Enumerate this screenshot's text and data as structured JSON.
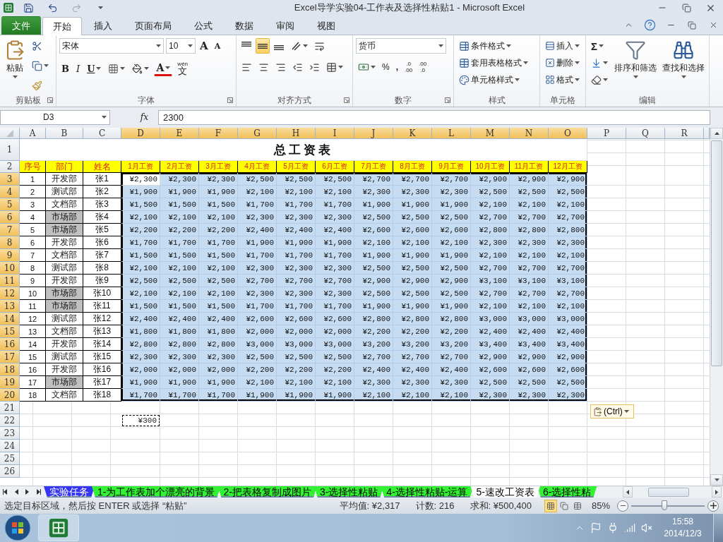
{
  "window": {
    "title": "Excel导学实验04-工作表及选择性粘贴1  -  Microsoft Excel"
  },
  "ribbon_tabs": [
    {
      "label": "文件",
      "kind": "file",
      "selected": false
    },
    {
      "label": "开始",
      "kind": "tab",
      "selected": true
    },
    {
      "label": "插入",
      "kind": "tab",
      "selected": false
    },
    {
      "label": "页面布局",
      "kind": "tab",
      "selected": false
    },
    {
      "label": "公式",
      "kind": "tab",
      "selected": false
    },
    {
      "label": "数据",
      "kind": "tab",
      "selected": false
    },
    {
      "label": "审阅",
      "kind": "tab",
      "selected": false
    },
    {
      "label": "视图",
      "kind": "tab",
      "selected": false
    }
  ],
  "ribbon": {
    "clipboard": {
      "label": "剪贴板",
      "paste": "粘贴"
    },
    "font": {
      "label": "字体",
      "font_name": "宋体",
      "font_size": "10",
      "grow": "A",
      "shrink": "A",
      "bold": "B",
      "italic": "I",
      "underline": "U",
      "color_letter": "A",
      "phonetic_top": "wén",
      "phonetic_char": "文"
    },
    "alignment": {
      "label": "对齐方式",
      "vertical": [
        {
          "selected": false
        },
        {
          "selected": true
        },
        {
          "selected": false
        }
      ]
    },
    "number": {
      "label": "数字",
      "format": "货币",
      "percent": "%",
      "comma": ",",
      "increase_top": ".0",
      "increase_bottom": ".00",
      "decrease_top": ".00",
      "decrease_bottom": ".0"
    },
    "styles": {
      "label": "样式",
      "items": [
        "条件格式",
        "套用表格格式",
        "单元格样式"
      ]
    },
    "cells": {
      "label": "单元格",
      "items": [
        "插入",
        "删除",
        "格式"
      ]
    },
    "editing": {
      "label": "编辑",
      "sum": "Σ",
      "sort": "排序和筛选",
      "find": "查找和选择"
    }
  },
  "formula_bar": {
    "name_box": "D3",
    "function_label": "fx",
    "content": "2300"
  },
  "columns": [
    {
      "label": "A",
      "selected": false
    },
    {
      "label": "B",
      "selected": false
    },
    {
      "label": "C",
      "selected": false
    },
    {
      "label": "D",
      "selected": true
    },
    {
      "label": "E",
      "selected": true
    },
    {
      "label": "F",
      "selected": true
    },
    {
      "label": "G",
      "selected": true
    },
    {
      "label": "H",
      "selected": true
    },
    {
      "label": "I",
      "selected": true
    },
    {
      "label": "J",
      "selected": true
    },
    {
      "label": "K",
      "selected": true
    },
    {
      "label": "L",
      "selected": true
    },
    {
      "label": "M",
      "selected": true
    },
    {
      "label": "N",
      "selected": true
    },
    {
      "label": "O",
      "selected": true
    },
    {
      "label": "P",
      "selected": false
    },
    {
      "label": "Q",
      "selected": false
    },
    {
      "label": "R",
      "selected": false
    }
  ],
  "title_row": {
    "num": "1",
    "selected": false,
    "title": "总工资表"
  },
  "header_row": {
    "num": "2",
    "selected": false,
    "headers": [
      "序号",
      "部门",
      "姓名",
      "1月工资",
      "2月工资",
      "3月工资",
      "4月工资",
      "5月工资",
      "6月工资",
      "7月工资",
      "8月工资",
      "9月工资",
      "10月工资",
      "11月工资",
      "12月工资"
    ]
  },
  "rows": [
    {
      "num": "3",
      "selected": true,
      "active": true,
      "seq": "1",
      "dept": "开发部",
      "dept_highlight": false,
      "name": "张1",
      "salaries": [
        "¥2,300",
        "¥2,300",
        "¥2,300",
        "¥2,500",
        "¥2,500",
        "¥2,500",
        "¥2,700",
        "¥2,700",
        "¥2,700",
        "¥2,900",
        "¥2,900",
        "¥2,900"
      ]
    },
    {
      "num": "4",
      "selected": true,
      "active": false,
      "seq": "2",
      "dept": "测试部",
      "dept_highlight": false,
      "name": "张2",
      "salaries": [
        "¥1,900",
        "¥1,900",
        "¥1,900",
        "¥2,100",
        "¥2,100",
        "¥2,100",
        "¥2,300",
        "¥2,300",
        "¥2,300",
        "¥2,500",
        "¥2,500",
        "¥2,500"
      ]
    },
    {
      "num": "5",
      "selected": true,
      "active": false,
      "seq": "3",
      "dept": "文档部",
      "dept_highlight": false,
      "name": "张3",
      "salaries": [
        "¥1,500",
        "¥1,500",
        "¥1,500",
        "¥1,700",
        "¥1,700",
        "¥1,700",
        "¥1,900",
        "¥1,900",
        "¥1,900",
        "¥2,100",
        "¥2,100",
        "¥2,100"
      ]
    },
    {
      "num": "6",
      "selected": true,
      "active": false,
      "seq": "4",
      "dept": "市场部",
      "dept_highlight": true,
      "name": "张4",
      "salaries": [
        "¥2,100",
        "¥2,100",
        "¥2,100",
        "¥2,300",
        "¥2,300",
        "¥2,300",
        "¥2,500",
        "¥2,500",
        "¥2,500",
        "¥2,700",
        "¥2,700",
        "¥2,700"
      ]
    },
    {
      "num": "7",
      "selected": true,
      "active": false,
      "seq": "5",
      "dept": "市场部",
      "dept_highlight": true,
      "name": "张5",
      "salaries": [
        "¥2,200",
        "¥2,200",
        "¥2,200",
        "¥2,400",
        "¥2,400",
        "¥2,400",
        "¥2,600",
        "¥2,600",
        "¥2,600",
        "¥2,800",
        "¥2,800",
        "¥2,800"
      ]
    },
    {
      "num": "8",
      "selected": true,
      "active": false,
      "seq": "6",
      "dept": "开发部",
      "dept_highlight": false,
      "name": "张6",
      "salaries": [
        "¥1,700",
        "¥1,700",
        "¥1,700",
        "¥1,900",
        "¥1,900",
        "¥1,900",
        "¥2,100",
        "¥2,100",
        "¥2,100",
        "¥2,300",
        "¥2,300",
        "¥2,300"
      ]
    },
    {
      "num": "9",
      "selected": true,
      "active": false,
      "seq": "7",
      "dept": "文档部",
      "dept_highlight": false,
      "name": "张7",
      "salaries": [
        "¥1,500",
        "¥1,500",
        "¥1,500",
        "¥1,700",
        "¥1,700",
        "¥1,700",
        "¥1,900",
        "¥1,900",
        "¥1,900",
        "¥2,100",
        "¥2,100",
        "¥2,100"
      ]
    },
    {
      "num": "10",
      "selected": true,
      "active": false,
      "seq": "8",
      "dept": "测试部",
      "dept_highlight": false,
      "name": "张8",
      "salaries": [
        "¥2,100",
        "¥2,100",
        "¥2,100",
        "¥2,300",
        "¥2,300",
        "¥2,300",
        "¥2,500",
        "¥2,500",
        "¥2,500",
        "¥2,700",
        "¥2,700",
        "¥2,700"
      ]
    },
    {
      "num": "11",
      "selected": true,
      "active": false,
      "seq": "9",
      "dept": "开发部",
      "dept_highlight": false,
      "name": "张9",
      "salaries": [
        "¥2,500",
        "¥2,500",
        "¥2,500",
        "¥2,700",
        "¥2,700",
        "¥2,700",
        "¥2,900",
        "¥2,900",
        "¥2,900",
        "¥3,100",
        "¥3,100",
        "¥3,100"
      ]
    },
    {
      "num": "12",
      "selected": true,
      "active": false,
      "seq": "10",
      "dept": "市场部",
      "dept_highlight": true,
      "name": "张10",
      "salaries": [
        "¥2,100",
        "¥2,100",
        "¥2,100",
        "¥2,300",
        "¥2,300",
        "¥2,300",
        "¥2,500",
        "¥2,500",
        "¥2,500",
        "¥2,700",
        "¥2,700",
        "¥2,700"
      ]
    },
    {
      "num": "13",
      "selected": true,
      "active": false,
      "seq": "11",
      "dept": "市场部",
      "dept_highlight": true,
      "name": "张11",
      "salaries": [
        "¥1,500",
        "¥1,500",
        "¥1,500",
        "¥1,700",
        "¥1,700",
        "¥1,700",
        "¥1,900",
        "¥1,900",
        "¥1,900",
        "¥2,100",
        "¥2,100",
        "¥2,100"
      ]
    },
    {
      "num": "14",
      "selected": true,
      "active": false,
      "seq": "12",
      "dept": "测试部",
      "dept_highlight": false,
      "name": "张12",
      "salaries": [
        "¥2,400",
        "¥2,400",
        "¥2,400",
        "¥2,600",
        "¥2,600",
        "¥2,600",
        "¥2,800",
        "¥2,800",
        "¥2,800",
        "¥3,000",
        "¥3,000",
        "¥3,000"
      ]
    },
    {
      "num": "15",
      "selected": true,
      "active": false,
      "seq": "13",
      "dept": "文档部",
      "dept_highlight": false,
      "name": "张13",
      "salaries": [
        "¥1,800",
        "¥1,800",
        "¥1,800",
        "¥2,000",
        "¥2,000",
        "¥2,000",
        "¥2,200",
        "¥2,200",
        "¥2,200",
        "¥2,400",
        "¥2,400",
        "¥2,400"
      ]
    },
    {
      "num": "16",
      "selected": true,
      "active": false,
      "seq": "14",
      "dept": "开发部",
      "dept_highlight": false,
      "name": "张14",
      "salaries": [
        "¥2,800",
        "¥2,800",
        "¥2,800",
        "¥3,000",
        "¥3,000",
        "¥3,000",
        "¥3,200",
        "¥3,200",
        "¥3,200",
        "¥3,400",
        "¥3,400",
        "¥3,400"
      ]
    },
    {
      "num": "17",
      "selected": true,
      "active": false,
      "seq": "15",
      "dept": "测试部",
      "dept_highlight": false,
      "name": "张15",
      "salaries": [
        "¥2,300",
        "¥2,300",
        "¥2,300",
        "¥2,500",
        "¥2,500",
        "¥2,500",
        "¥2,700",
        "¥2,700",
        "¥2,700",
        "¥2,900",
        "¥2,900",
        "¥2,900"
      ]
    },
    {
      "num": "18",
      "selected": true,
      "active": false,
      "seq": "16",
      "dept": "开发部",
      "dept_highlight": false,
      "name": "张16",
      "salaries": [
        "¥2,000",
        "¥2,000",
        "¥2,000",
        "¥2,200",
        "¥2,200",
        "¥2,200",
        "¥2,400",
        "¥2,400",
        "¥2,400",
        "¥2,600",
        "¥2,600",
        "¥2,600"
      ]
    },
    {
      "num": "19",
      "selected": true,
      "active": false,
      "seq": "17",
      "dept": "市场部",
      "dept_highlight": true,
      "name": "张17",
      "salaries": [
        "¥1,900",
        "¥1,900",
        "¥1,900",
        "¥2,100",
        "¥2,100",
        "¥2,100",
        "¥2,300",
        "¥2,300",
        "¥2,300",
        "¥2,500",
        "¥2,500",
        "¥2,500"
      ]
    },
    {
      "num": "20",
      "selected": true,
      "active": false,
      "seq": "18",
      "dept": "文档部",
      "dept_highlight": false,
      "name": "张18",
      "salaries": [
        "¥1,700",
        "¥1,700",
        "¥1,700",
        "¥1,900",
        "¥1,900",
        "¥1,900",
        "¥2,100",
        "¥2,100",
        "¥2,100",
        "¥2,300",
        "¥2,300",
        "¥2,300"
      ]
    }
  ],
  "empty_rows": [
    {
      "num": "21",
      "selected": false
    },
    {
      "num": "22",
      "selected": false,
      "copied": "¥300"
    },
    {
      "num": "23",
      "selected": false
    },
    {
      "num": "24",
      "selected": false
    },
    {
      "num": "25",
      "selected": false
    },
    {
      "num": "26",
      "selected": false
    }
  ],
  "paste_options": {
    "label": "(Ctrl)"
  },
  "sheet_tabs": [
    {
      "label": "实验任务",
      "color": "#3535f5",
      "selected": false
    },
    {
      "label": "1-为工作表加个漂亮的背景",
      "color": "#33f233",
      "selected": false
    },
    {
      "label": "2-把表格复制成图片",
      "color": "#33f233",
      "selected": false
    },
    {
      "label": "3-选择性粘贴",
      "color": "#33f233",
      "selected": false
    },
    {
      "label": "4-选择性粘贴-运算",
      "color": "#33f233",
      "selected": false
    },
    {
      "label": "5-速改工资表",
      "color": "#ffffff",
      "selected": true
    },
    {
      "label": "6-选择性粘",
      "color": "#33f233",
      "selected": false
    }
  ],
  "status_bar": {
    "message": "选定目标区域，然后按 ENTER 或选择 “粘贴”",
    "average": "平均值: ¥2,317",
    "count": "计数: 216",
    "sum": "求和: ¥500,400",
    "views": [
      {
        "selected": true
      },
      {
        "selected": false
      },
      {
        "selected": false
      }
    ],
    "zoom": "85%",
    "zoom_slider": {
      "level": 0.45
    }
  },
  "taskbar": {
    "time": "15:58",
    "date": "2014/12/3"
  }
}
